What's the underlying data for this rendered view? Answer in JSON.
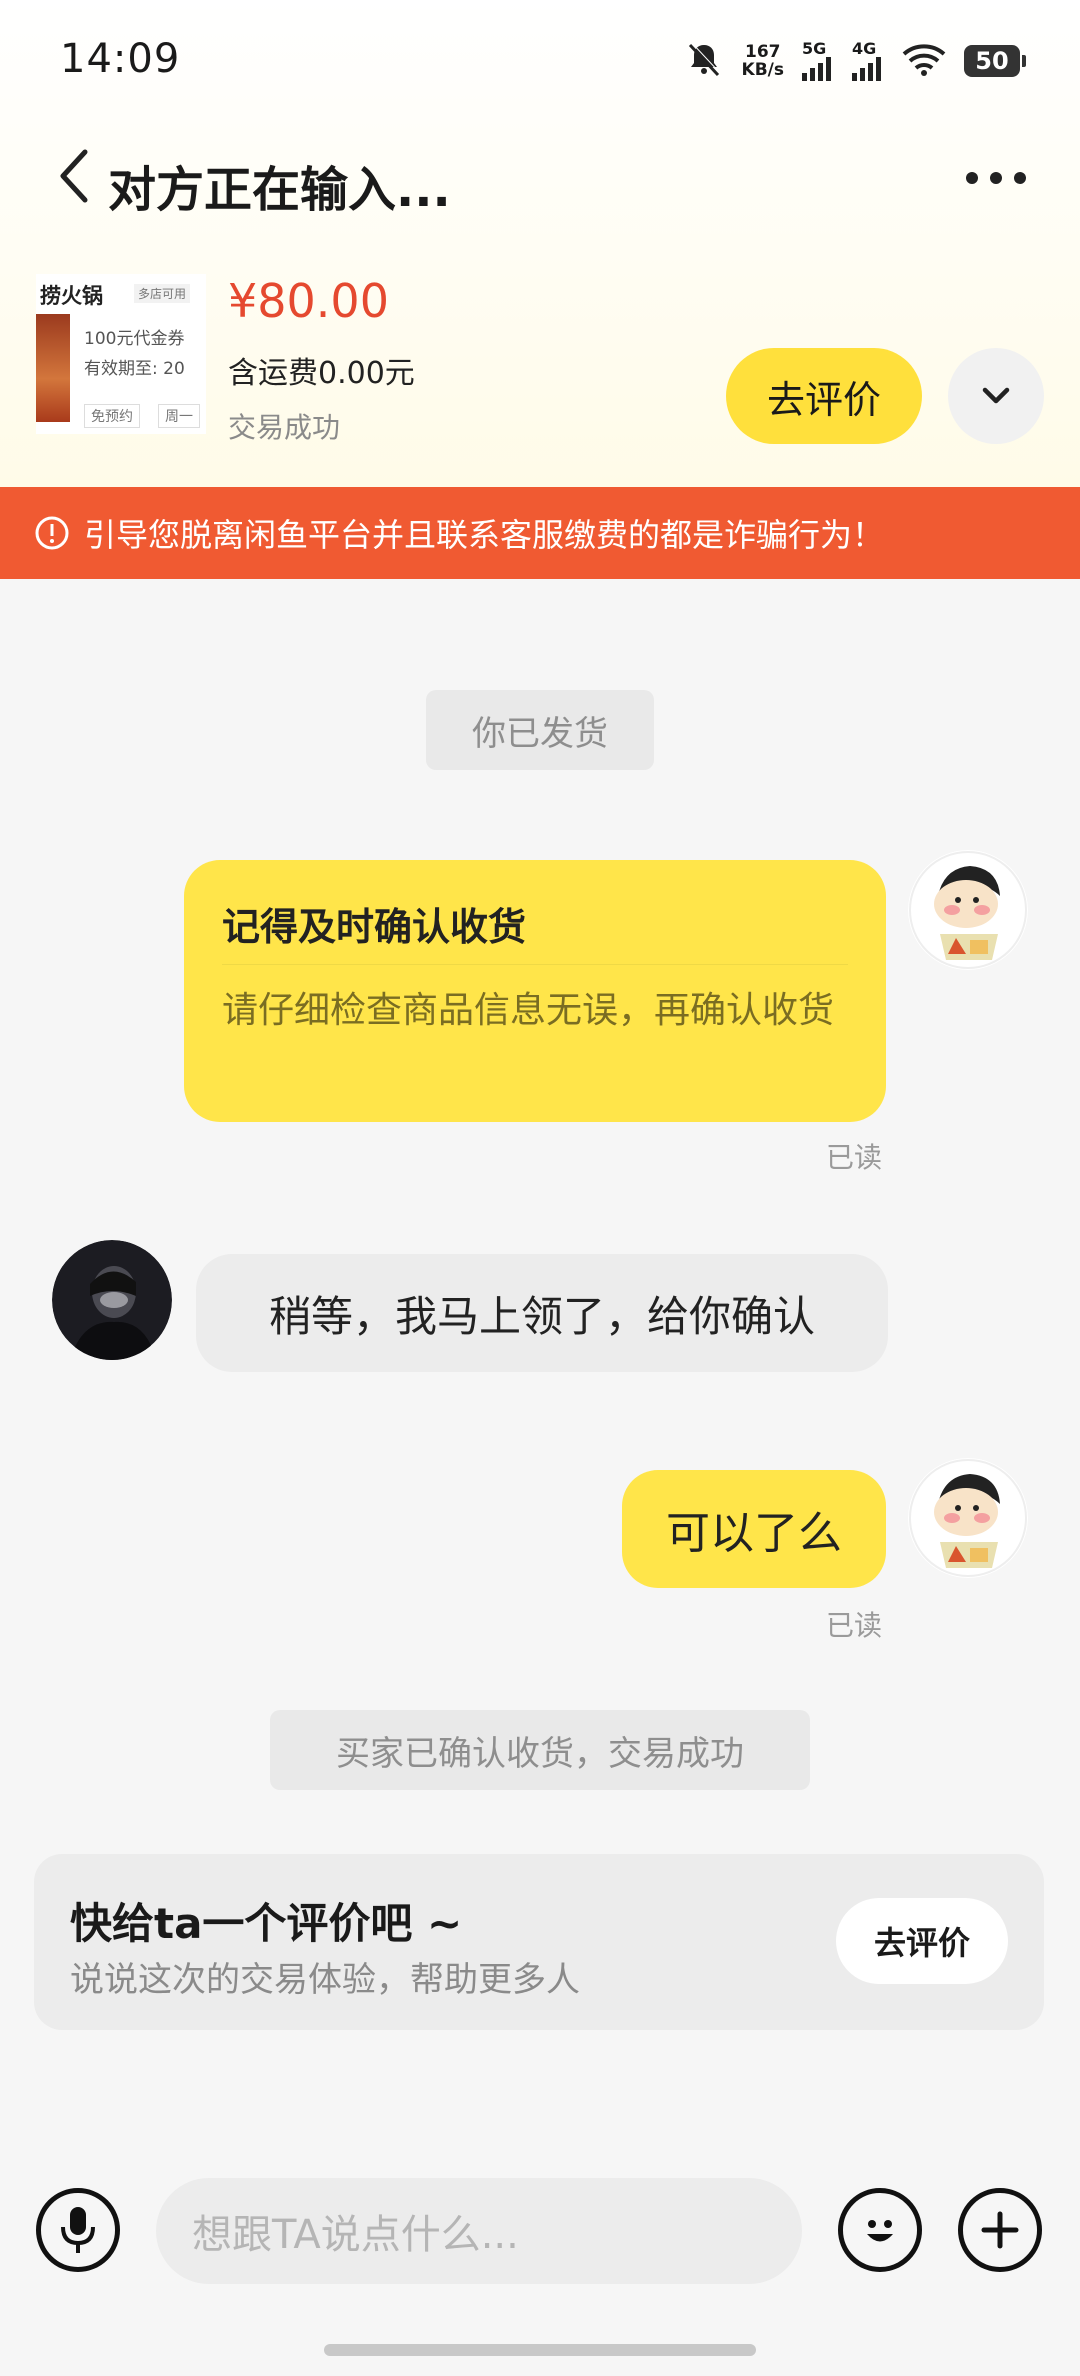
{
  "status_bar": {
    "time": "14:09",
    "net_speed_value": "167",
    "net_speed_unit": "KB/s",
    "sig1_label": "5G",
    "sig2_label": "4G",
    "battery": "50"
  },
  "nav": {
    "title": "对方正在输入..."
  },
  "product": {
    "thumb_title": "捞火锅",
    "thumb_tag": "多店可用",
    "thumb_line1": "100元代金券",
    "thumb_line2": "有效期至: 20",
    "thumb_chip1": "免预约",
    "thumb_chip2": "周一",
    "price": "¥80.00",
    "shipping": "含运费0.00元",
    "status": "交易成功",
    "review_button": "去评价"
  },
  "warning": {
    "text": "引导您脱离闲鱼平台并且联系客服缴费的都是诈骗行为！"
  },
  "messages": {
    "sys_shipped": "你已发货",
    "card_title": "记得及时确认收货",
    "card_body": "请仔细检查商品信息无误，再确认收货",
    "read1": "已读",
    "buyer_msg": "稍等，我马上领了，给你确认",
    "seller_msg": "可以了么",
    "read2": "已读",
    "sys_confirmed": "买家已确认收货，交易成功"
  },
  "review_card": {
    "title": "快给ta一个评价吧 ~",
    "subtitle": "说说这次的交易体验，帮助更多人",
    "button": "去评价"
  },
  "input": {
    "placeholder": "想跟TA说点什么..."
  },
  "colors": {
    "accent_yellow": "#ffe03c",
    "warning_red": "#f05a32",
    "price_red": "#e5492f"
  }
}
